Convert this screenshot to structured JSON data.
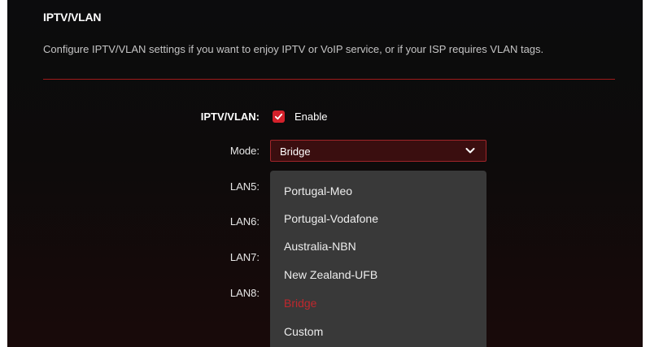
{
  "section": {
    "title": "IPTV/VLAN",
    "description": "Configure IPTV/VLAN settings if you want to enjoy IPTV or VoIP service, or if your ISP requires VLAN tags."
  },
  "form": {
    "iptv_label": "IPTV/VLAN:",
    "enable_label": "Enable",
    "enable_checked": true,
    "mode_label": "Mode:",
    "mode_value": "Bridge",
    "lan5_label": "LAN5:",
    "lan6_label": "LAN6:",
    "lan7_label": "LAN7:",
    "lan8_label": "LAN8:"
  },
  "dropdown": {
    "options": [
      {
        "label": "Portugal-Meo"
      },
      {
        "label": "Portugal-Vodafone"
      },
      {
        "label": "Australia-NBN"
      },
      {
        "label": "New Zealand-UFB"
      },
      {
        "label": "Bridge",
        "selected": true
      },
      {
        "label": "Custom"
      }
    ]
  },
  "colors": {
    "accent": "#d4212b",
    "selected_option": "#c0272d",
    "divider": "#a01b1b",
    "dropdown_bg": "#393939",
    "select_bg": "#3a0e0f"
  },
  "icons": {
    "checkbox": "check-icon",
    "select": "chevron-down-icon"
  }
}
